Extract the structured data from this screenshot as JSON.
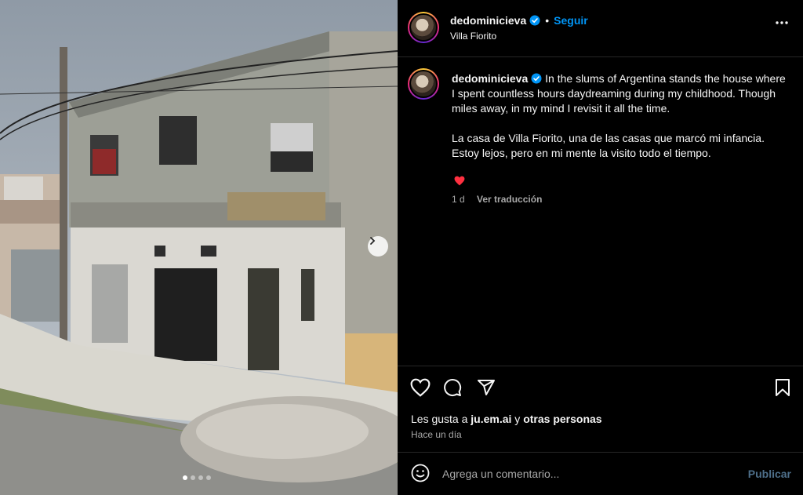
{
  "post": {
    "username": "dedominicieva",
    "follow_label": "Seguir",
    "separator": "•",
    "location": "Villa Fiorito",
    "caption_en": "In the slums of Argentina stands the house where I spent countless hours daydreaming during my childhood. Though miles away, in my mind I revisit it all the time.",
    "caption_es": "La casa de Villa Fiorito, una de las casas que marcó mi infancia. Estoy lejos, pero en mi mente la visito todo el tiempo.",
    "time_ago": "1 d",
    "translate_label": "Ver traducción"
  },
  "likes": {
    "prefix": "Les gusta a ",
    "user": "ju.em.ai",
    "middle": " y ",
    "others": "otras personas",
    "posted": "Hace un día"
  },
  "comment": {
    "placeholder": "Agrega un comentario...",
    "publish_label": "Publicar"
  },
  "carousel": {
    "total": 4,
    "current": 1
  },
  "icons": {
    "verified": "verified-badge-icon",
    "more": "more-options-icon",
    "like": "heart-icon",
    "comment": "comment-bubble-icon",
    "share": "send-paper-plane-icon",
    "save": "bookmark-icon",
    "emoji": "smiley-face-icon",
    "next": "chevron-right-icon"
  },
  "colors": {
    "accent": "#0095f6",
    "like_red": "#ff3040",
    "muted": "#a8a8a8"
  }
}
